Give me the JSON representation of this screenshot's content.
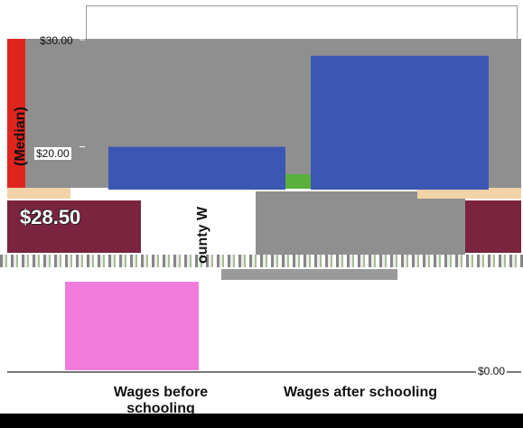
{
  "chart_data": {
    "type": "bar",
    "categories": [
      "Wages before schooling",
      "Wages after schooling"
    ],
    "values": [
      20.0,
      28.5
    ],
    "ylabel": "(Median)",
    "ylim": [
      0,
      30
    ],
    "yticks": [
      "$30.00",
      "$20.00",
      "$0.00"
    ],
    "bar_colors": [
      "#3b57b3",
      "#3b57b3"
    ],
    "annotation": "$28.50",
    "side_label": "ounty W"
  },
  "colors": {
    "gray": "#8f8f8f",
    "maroon": "#7a2440",
    "red": "#e0251f",
    "pink": "#f07ddc",
    "green": "#5ab03a",
    "tan": "#f2d2a8"
  }
}
